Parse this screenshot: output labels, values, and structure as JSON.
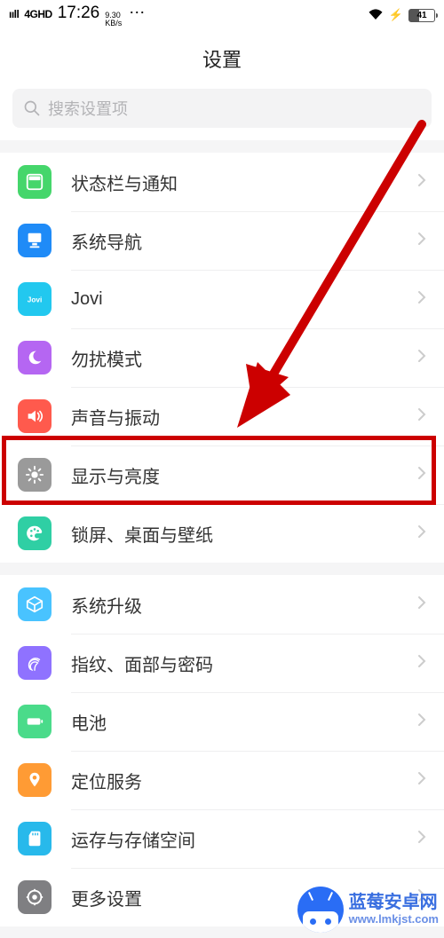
{
  "status_bar": {
    "network_label": "4GHD",
    "time": "17:26",
    "speed_top": "9.30",
    "speed_bot": "KB/s",
    "battery_pct": "41"
  },
  "header": {
    "title": "设置"
  },
  "search": {
    "placeholder": "搜索设置项"
  },
  "groups": [
    {
      "items": [
        {
          "key": "status",
          "label": "状态栏与通知"
        },
        {
          "key": "nav",
          "label": "系统导航"
        },
        {
          "key": "jovi",
          "label": "Jovi"
        },
        {
          "key": "dnd",
          "label": "勿扰模式"
        },
        {
          "key": "sound",
          "label": "声音与振动"
        },
        {
          "key": "display",
          "label": "显示与亮度"
        },
        {
          "key": "lock",
          "label": "锁屏、桌面与壁纸"
        }
      ]
    },
    {
      "items": [
        {
          "key": "update",
          "label": "系统升级"
        },
        {
          "key": "biom",
          "label": "指纹、面部与密码"
        },
        {
          "key": "battery",
          "label": "电池"
        },
        {
          "key": "loc",
          "label": "定位服务"
        },
        {
          "key": "storage",
          "label": "运存与存储空间"
        },
        {
          "key": "more",
          "label": "更多设置"
        }
      ]
    }
  ],
  "annotation": {
    "highlight_item": "display",
    "colors": {
      "box": "#cc0000",
      "arrow": "#cc0000"
    }
  },
  "watermark": {
    "cn": "蓝莓安卓网",
    "en": "www.lmkjst.com"
  }
}
